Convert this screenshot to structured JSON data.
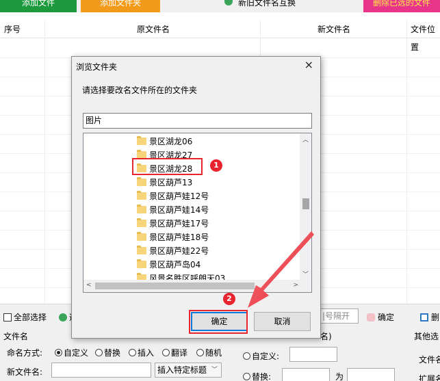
{
  "toolbar": {
    "add_file": "添加文件",
    "add_folder": "添加文件夹",
    "refresh": "新旧文件名互换",
    "delete_selected": "删除已选的文件"
  },
  "table": {
    "columns": [
      "序号",
      "原文件名",
      "新文件名",
      "文件位置"
    ]
  },
  "dialog": {
    "title": "浏览文件夹",
    "close": "×",
    "prompt": "请选择要改名文件所在的文件夹",
    "path_value": "图片",
    "folders": [
      "景区湖龙06",
      "景区湖龙27",
      "景区湖龙28",
      "景区葫芦13",
      "景区葫芦娃12号",
      "景区葫芦娃14号",
      "景区葫芦娃17号",
      "景区葫芦娃18号",
      "景区葫芦娃22号",
      "景区葫芦岛04",
      "风景名胜区呼朗天03"
    ],
    "selected_folder": "景区湖龙28",
    "ok": "确定",
    "cancel": "取消"
  },
  "annotations": {
    "step1": "1",
    "step2": "2",
    "color": "#e8242f"
  },
  "bottom": {
    "select_all": "全部选择",
    "confirm_partial": "选",
    "separator_hint": "|号隔开",
    "confirm": "确定",
    "delete_partial": "删",
    "section_filename": "文件名",
    "naming_mode_label": "命名方式:",
    "modes": [
      "自定义",
      "替换",
      "插入",
      "翻译",
      "随机"
    ],
    "new_name_label": "新文件名:",
    "insert_title": "插入特定标题",
    "ext_section": "名)",
    "ext_custom": "自定义:",
    "ext_replace": "替换:",
    "ext_to": "为",
    "other_section": "其他选",
    "file_name_right": "文件名",
    "ext_name_right": "扩展名"
  },
  "colors": {
    "green_button": "#1e9a3e",
    "orange_button": "#f29b1a",
    "pink_button": "#e8358a",
    "ok_focus": "#0078d7"
  }
}
